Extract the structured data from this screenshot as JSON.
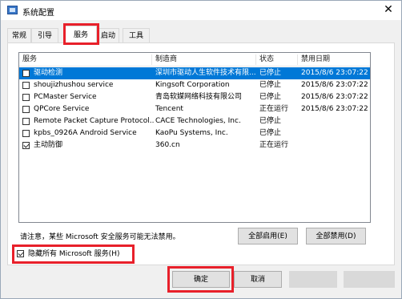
{
  "window": {
    "title": "系统配置",
    "close_glyph": "✕"
  },
  "tabs": [
    {
      "label": "常规"
    },
    {
      "label": "引导"
    },
    {
      "label": "服务"
    },
    {
      "label": "启动"
    },
    {
      "label": "工具"
    }
  ],
  "table": {
    "columns": [
      "服务",
      "制造商",
      "状态",
      "禁用日期"
    ],
    "rows": [
      {
        "service": "驱动检测",
        "maker": "深圳市驱动人生软件技术有限...",
        "status": "已停止",
        "date": "2015/8/6 23:07:22",
        "checked": false,
        "selected": true
      },
      {
        "service": "shoujizhushou service",
        "maker": "Kingsoft Corporation",
        "status": "已停止",
        "date": "2015/8/6 23:07:22",
        "checked": false,
        "selected": false
      },
      {
        "service": "PCMaster Service",
        "maker": "青岛软媒网络科技有限公司",
        "status": "已停止",
        "date": "2015/8/6 23:07:22",
        "checked": false,
        "selected": false
      },
      {
        "service": "QPCore Service",
        "maker": "Tencent",
        "status": "正在运行",
        "date": "2015/8/6 23:07:22",
        "checked": false,
        "selected": false
      },
      {
        "service": "Remote Packet Capture Protocol...",
        "maker": "CACE Technologies, Inc.",
        "status": "已停止",
        "date": "",
        "checked": false,
        "selected": false
      },
      {
        "service": "kpbs_0926A Android Service",
        "maker": "KaoPu Systems, Inc.",
        "status": "已停止",
        "date": "",
        "checked": false,
        "selected": false
      },
      {
        "service": "主动防御",
        "maker": "360.cn",
        "status": "正在运行",
        "date": "",
        "checked": true,
        "selected": false
      }
    ]
  },
  "notice": "请注意，某些 Microsoft 安全服务可能无法禁用。",
  "buttons": {
    "enable_all": "全部启用(E)",
    "disable_all": "全部禁用(D)",
    "ok": "确定",
    "cancel": "取消"
  },
  "hide_ms": {
    "label": "隐藏所有 Microsoft 服务(H)",
    "checked": true
  },
  "colors": {
    "selection": "#0078d7",
    "highlight": "#e8202a"
  }
}
